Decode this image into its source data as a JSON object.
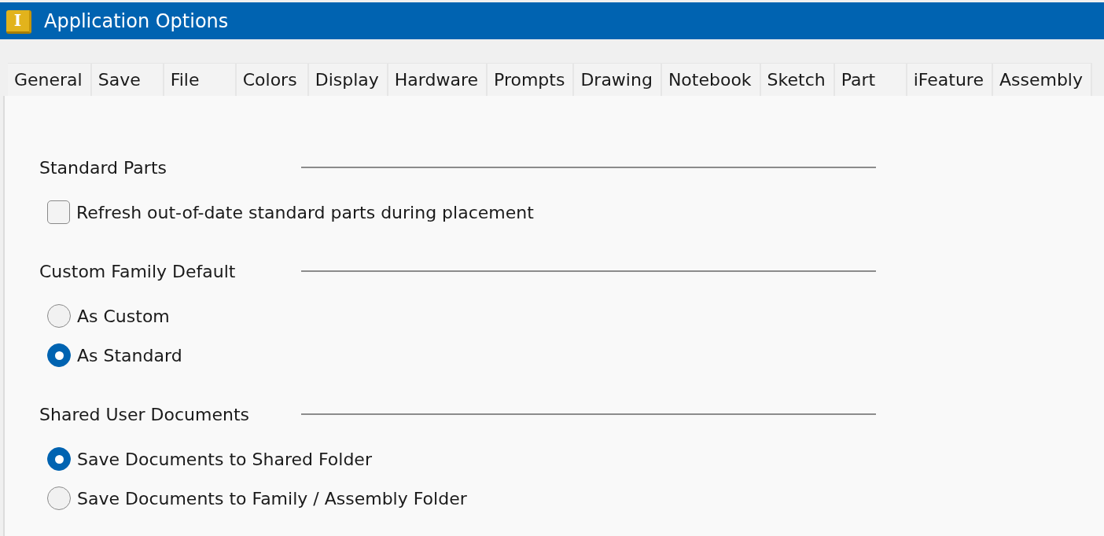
{
  "window": {
    "icon_letter": "I",
    "title": "Application Options"
  },
  "tabs": [
    {
      "label": "General",
      "selected": false
    },
    {
      "label": "Save",
      "selected": false
    },
    {
      "label": "File",
      "selected": false
    },
    {
      "label": "Colors",
      "selected": false
    },
    {
      "label": "Display",
      "selected": false
    },
    {
      "label": "Hardware",
      "selected": false
    },
    {
      "label": "Prompts",
      "selected": false
    },
    {
      "label": "Drawing",
      "selected": false
    },
    {
      "label": "Notebook",
      "selected": false
    },
    {
      "label": "Sketch",
      "selected": false
    },
    {
      "label": "Part",
      "selected": false
    },
    {
      "label": "iFeature",
      "selected": false
    },
    {
      "label": "Assembly",
      "selected": false
    }
  ],
  "sections": [
    {
      "heading": "Standard Parts",
      "options": [
        {
          "kind": "checkbox",
          "label": "Refresh out-of-date standard parts during placement",
          "checked": false
        }
      ]
    },
    {
      "heading": "Custom Family Default",
      "options": [
        {
          "kind": "radio",
          "label": "As Custom",
          "selected": false
        },
        {
          "kind": "radio",
          "label": "As Standard",
          "selected": true
        }
      ]
    },
    {
      "heading": "Shared User Documents",
      "options": [
        {
          "kind": "radio",
          "label": "Save Documents to Shared Folder",
          "selected": true
        },
        {
          "kind": "radio",
          "label": "Save Documents to Family / Assembly Folder",
          "selected": false
        }
      ]
    }
  ]
}
